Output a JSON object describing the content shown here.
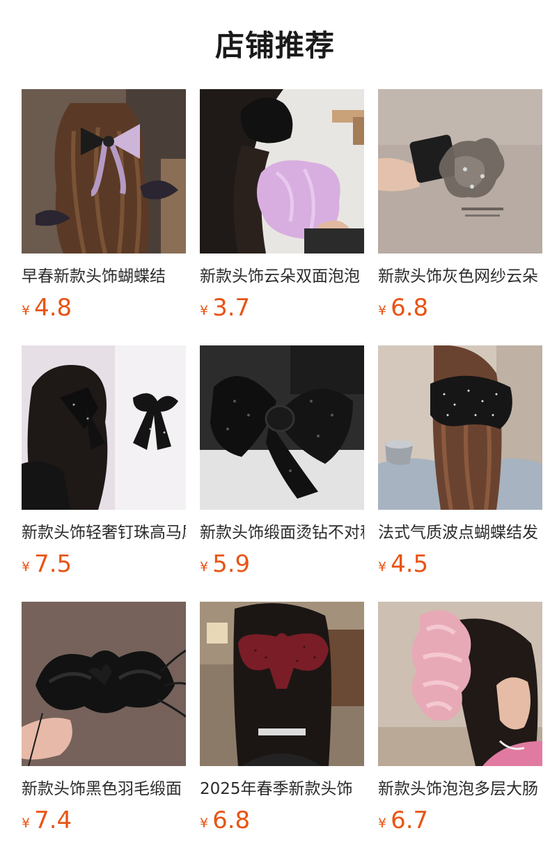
{
  "section": {
    "title": "店铺推荐"
  },
  "colors": {
    "price": "#e85414",
    "title": "#1a1a1a",
    "name": "#2b2b2b"
  },
  "products": [
    {
      "name": "早春新款头饰蝴蝶结",
      "currency": "¥",
      "price": "4.8",
      "image": "bow-hairclip-photo"
    },
    {
      "name": "新款头饰云朵双面泡泡",
      "currency": "¥",
      "price": "3.7",
      "image": "cloud-scrunchie-photo"
    },
    {
      "name": "新款头饰灰色网纱云朵",
      "currency": "¥",
      "price": "6.8",
      "image": "gray-mesh-scrunchie-photo"
    },
    {
      "name": "新款头饰轻奢钉珠高马尾",
      "currency": "¥",
      "price": "7.5",
      "image": "studded-bow-photo"
    },
    {
      "name": "新款头饰缎面烫钻不对称",
      "currency": "¥",
      "price": "5.9",
      "image": "satin-rhinestone-bow-photo"
    },
    {
      "name": "法式气质波点蝴蝶结发",
      "currency": "¥",
      "price": "4.5",
      "image": "polka-dot-bow-photo"
    },
    {
      "name": "新款头饰黑色羽毛缎面",
      "currency": "¥",
      "price": "7.4",
      "image": "feather-satin-claw-photo"
    },
    {
      "name": "2025年春季新款头饰",
      "currency": "¥",
      "price": "6.8",
      "image": "burgundy-bow-photo"
    },
    {
      "name": "新款头饰泡泡多层大肠",
      "currency": "¥",
      "price": "6.7",
      "image": "pink-layered-scrunchie-photo"
    }
  ]
}
